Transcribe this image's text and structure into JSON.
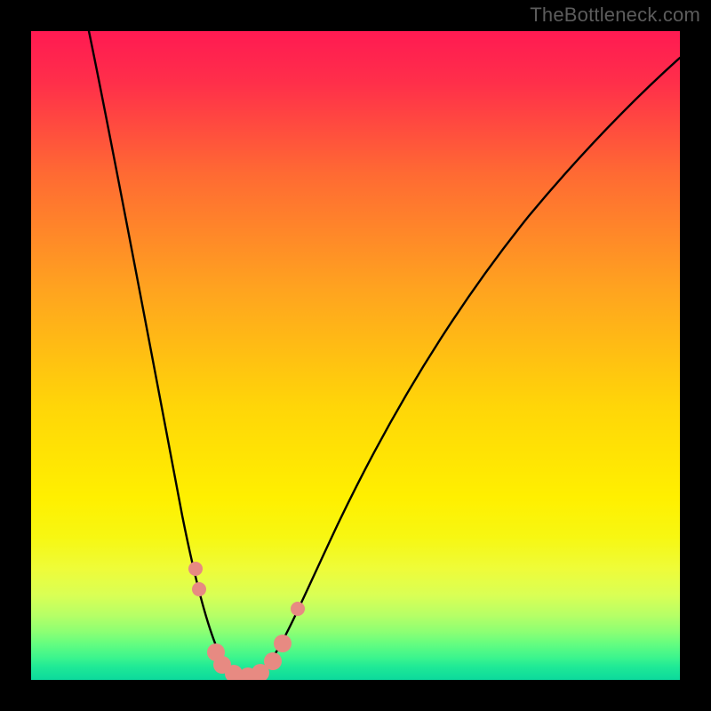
{
  "watermark": "TheBottleneck.com",
  "colors": {
    "dot": "#e78a82",
    "curve": "#000000",
    "gradient_top": "#ff1a52",
    "gradient_bottom": "#0cd99c",
    "background": "#000000"
  },
  "chart_data": {
    "type": "line",
    "title": "",
    "xlabel": "",
    "ylabel": "",
    "xlim": [
      0,
      100
    ],
    "ylim": [
      0,
      100
    ],
    "series": [
      {
        "name": "bottleneck_curve",
        "x": [
          9,
          12,
          16,
          20,
          23,
          26,
          29.5,
          31,
          33,
          36,
          40,
          47,
          56,
          66,
          77,
          100
        ],
        "y": [
          100,
          84,
          60,
          37,
          24,
          12,
          3.5,
          1,
          0.3,
          2.5,
          8,
          24,
          44,
          62,
          78,
          96
        ]
      }
    ],
    "highlighted_points": {
      "name": "dots",
      "x": [
        25.3,
        25.9,
        28.5,
        29.5,
        31.2,
        33.4,
        35.3,
        37.3,
        38.8,
        41.1
      ],
      "y": [
        17.1,
        14.0,
        4.2,
        2.3,
        1.0,
        0.5,
        1.1,
        2.9,
        5.6,
        11.0
      ]
    },
    "background_heatmap": {
      "orientation": "vertical",
      "stops": [
        {
          "pos": 0.0,
          "color": "#ff1a52"
        },
        {
          "pos": 0.08,
          "color": "#ff2f4a"
        },
        {
          "pos": 0.22,
          "color": "#ff6a33"
        },
        {
          "pos": 0.4,
          "color": "#ffa41f"
        },
        {
          "pos": 0.58,
          "color": "#ffd608"
        },
        {
          "pos": 0.72,
          "color": "#fff000"
        },
        {
          "pos": 0.78,
          "color": "#f7f712"
        },
        {
          "pos": 0.83,
          "color": "#eefc3a"
        },
        {
          "pos": 0.87,
          "color": "#d9ff55"
        },
        {
          "pos": 0.9,
          "color": "#b7ff66"
        },
        {
          "pos": 0.925,
          "color": "#8eff73"
        },
        {
          "pos": 0.945,
          "color": "#63fd80"
        },
        {
          "pos": 0.965,
          "color": "#3df58d"
        },
        {
          "pos": 0.98,
          "color": "#1fe996"
        },
        {
          "pos": 1.0,
          "color": "#0cd99c"
        }
      ]
    }
  }
}
